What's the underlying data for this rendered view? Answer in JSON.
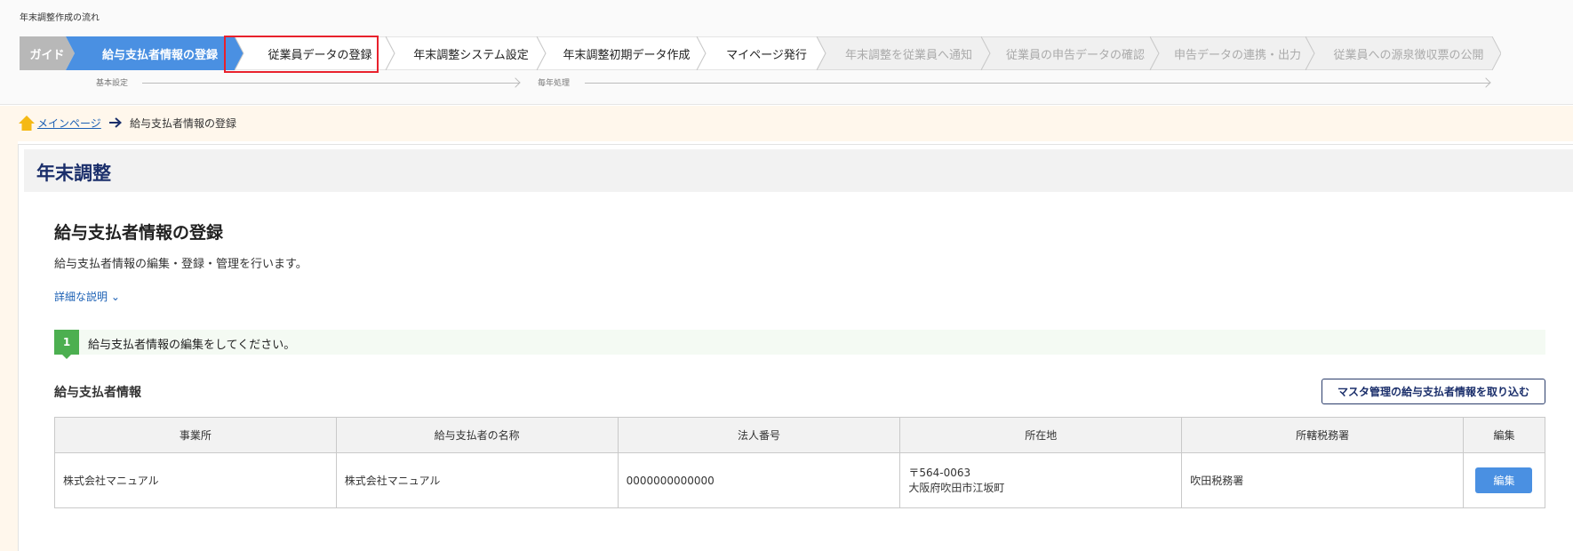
{
  "flow": {
    "title": "年末調整作成の流れ",
    "steps": [
      {
        "label": "ガイド",
        "state": "guide"
      },
      {
        "label": "給与支払者情報の登録",
        "state": "current"
      },
      {
        "label": "従業員データの登録",
        "state": "active"
      },
      {
        "label": "年末調整システム設定",
        "state": "active"
      },
      {
        "label": "年末調整初期データ作成",
        "state": "active"
      },
      {
        "label": "マイページ発行",
        "state": "active"
      },
      {
        "label": "年末調整を従業員へ通知",
        "state": "disabled"
      },
      {
        "label": "従業員の申告データの確認",
        "state": "disabled"
      },
      {
        "label": "申告データの連携・出力",
        "state": "disabled"
      },
      {
        "label": "従業員への源泉徴収票の公開",
        "state": "disabled"
      }
    ],
    "phases": [
      {
        "label": "基本設定"
      },
      {
        "label": "毎年処理"
      }
    ]
  },
  "breadcrumb": {
    "home": "メインページ",
    "current": "給与支払者情報の登録"
  },
  "panel": {
    "title": "年末調整"
  },
  "section": {
    "title": "給与支払者情報の登録",
    "description": "給与支払者情報の編集・登録・管理を行います。",
    "detail_link": "詳細な説明 ⌄"
  },
  "instruction": {
    "number": "1",
    "text": "給与支払者情報の編集をしてください。"
  },
  "payer_info": {
    "title": "給与支払者情報",
    "import_button": "マスタ管理の給与支払者情報を取り込む",
    "columns": [
      "事業所",
      "給与支払者の名称",
      "法人番号",
      "所在地",
      "所轄税務署",
      "編集"
    ],
    "rows": [
      {
        "office": "株式会社マニュアル",
        "payer_name": "株式会社マニュアル",
        "corporate_number": "0000000000000",
        "postal_code": "〒564-0063",
        "address": "大阪府吹田市江坂町",
        "tax_office": "吹田税務署",
        "edit_label": "編集"
      }
    ]
  },
  "colors": {
    "guide_step": "#b8b8b8",
    "current_step": "#4a90e2",
    "active_step": "#ffffff",
    "disabled_step": "#f0f0f0",
    "highlight_border": "#e8212c",
    "instruction_badge": "#4caf50",
    "edit_button": "#4a90e2",
    "title_navy": "#1b2f6b"
  },
  "icons": {
    "home": "home-icon",
    "breadcrumb_arrow": "arrow-right-icon"
  }
}
